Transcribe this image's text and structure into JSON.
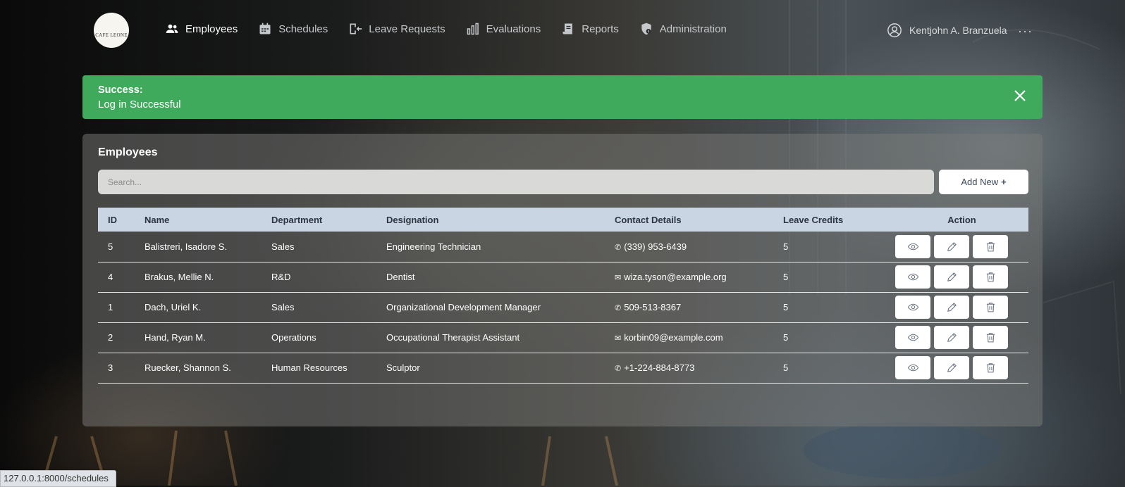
{
  "brand": {
    "logo_text": "CAFE LEONE"
  },
  "nav": {
    "items": [
      {
        "label": "Employees",
        "icon": "users-icon",
        "active": true
      },
      {
        "label": "Schedules",
        "icon": "calendar-icon",
        "active": false
      },
      {
        "label": "Leave Requests",
        "icon": "leave-icon",
        "active": false
      },
      {
        "label": "Evaluations",
        "icon": "bar-chart-icon",
        "active": false
      },
      {
        "label": "Reports",
        "icon": "report-icon",
        "active": false
      },
      {
        "label": "Administration",
        "icon": "shield-icon",
        "active": false
      }
    ],
    "user_name": "Kentjohn A. Branzuela",
    "more_label": "···"
  },
  "alert": {
    "title": "Success:",
    "message": "Log in Successful",
    "color": "#3fa95c"
  },
  "panel": {
    "title": "Employees",
    "search_placeholder": "Search...",
    "add_button_label": "Add New",
    "add_button_icon": "+"
  },
  "table": {
    "headers": {
      "id": "ID",
      "name": "Name",
      "department": "Department",
      "designation": "Designation",
      "contact": "Contact Details",
      "leave": "Leave Credits",
      "action": "Action"
    },
    "rows": [
      {
        "id": "5",
        "name": "Balistreri, Isadore S.",
        "department": "Sales",
        "designation": "Engineering Technician",
        "contact_icon": "✆",
        "contact": "(339) 953-6439",
        "leave": "5"
      },
      {
        "id": "4",
        "name": "Brakus, Mellie N.",
        "department": "R&D",
        "designation": "Dentist",
        "contact_icon": "✉",
        "contact": "wiza.tyson@example.org",
        "leave": "5"
      },
      {
        "id": "1",
        "name": "Dach, Uriel K.",
        "department": "Sales",
        "designation": "Organizational Development Manager",
        "contact_icon": "✆",
        "contact": "509-513-8367",
        "leave": "5"
      },
      {
        "id": "2",
        "name": "Hand, Ryan M.",
        "department": "Operations",
        "designation": "Occupational Therapist Assistant",
        "contact_icon": "✉",
        "contact": "korbin09@example.com",
        "leave": "5"
      },
      {
        "id": "3",
        "name": "Ruecker, Shannon S.",
        "department": "Human Resources",
        "designation": "Sculptor",
        "contact_icon": "✆",
        "contact": "+1-224-884-8773",
        "leave": "5"
      }
    ]
  },
  "statusbar": {
    "url": "127.0.0.1:8000/schedules"
  }
}
